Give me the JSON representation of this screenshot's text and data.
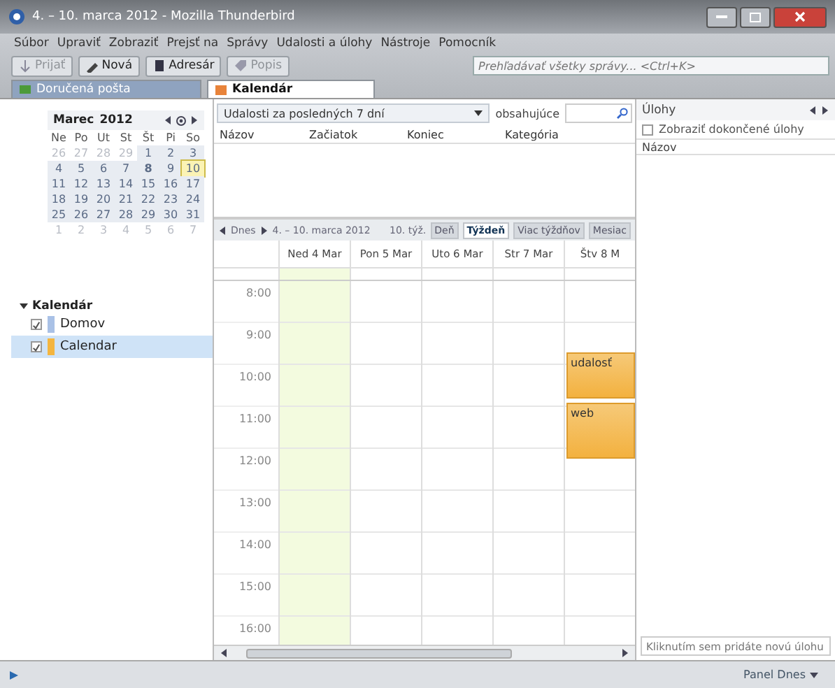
{
  "window": {
    "title": "4. – 10. marca 2012 - Mozilla Thunderbird"
  },
  "menu": [
    "Súbor",
    "Upraviť",
    "Zobraziť",
    "Prejsť na",
    "Správy",
    "Udalosti a úlohy",
    "Nástroje",
    "Pomocník"
  ],
  "toolbar": [
    {
      "label": "Prijať",
      "kind": "get",
      "disabled": true
    },
    {
      "label": "Nová",
      "kind": "new",
      "disabled": false
    },
    {
      "label": "Adresár",
      "kind": "book",
      "disabled": false
    },
    {
      "label": "Popis",
      "kind": "tag",
      "disabled": true
    }
  ],
  "global_search": {
    "placeholder": "Prehľadávať všetky správy... <Ctrl+K>"
  },
  "tabs": [
    {
      "label": "Doručená pošta",
      "kind": "mail",
      "selected": false
    },
    {
      "label": "Kalendár",
      "kind": "calendar",
      "selected": true
    }
  ],
  "minicalendar": {
    "month": "Marec",
    "year": "2012",
    "weekdays": [
      "Ne",
      "Po",
      "Ut",
      "St",
      "Št",
      "Pi",
      "So"
    ],
    "weeks": [
      [
        {
          "d": "26",
          "muted": true
        },
        {
          "d": "27",
          "muted": true
        },
        {
          "d": "28",
          "muted": true
        },
        {
          "d": "29",
          "muted": true
        },
        {
          "d": "1",
          "muted": false
        },
        {
          "d": "2",
          "muted": false
        },
        {
          "d": "3",
          "muted": false
        }
      ],
      [
        {
          "d": "4",
          "muted": false
        },
        {
          "d": "5",
          "muted": false
        },
        {
          "d": "6",
          "muted": false
        },
        {
          "d": "7",
          "muted": false
        },
        {
          "d": "8",
          "muted": false,
          "bold": true
        },
        {
          "d": "9",
          "muted": false
        },
        {
          "d": "10",
          "muted": false,
          "selected": true
        }
      ],
      [
        {
          "d": "11",
          "muted": false
        },
        {
          "d": "12",
          "muted": false
        },
        {
          "d": "13",
          "muted": false
        },
        {
          "d": "14",
          "muted": false
        },
        {
          "d": "15",
          "muted": false
        },
        {
          "d": "16",
          "muted": false
        },
        {
          "d": "17",
          "muted": false
        }
      ],
      [
        {
          "d": "18",
          "muted": false
        },
        {
          "d": "19",
          "muted": false
        },
        {
          "d": "20",
          "muted": false
        },
        {
          "d": "21",
          "muted": false
        },
        {
          "d": "22",
          "muted": false
        },
        {
          "d": "23",
          "muted": false
        },
        {
          "d": "24",
          "muted": false
        }
      ],
      [
        {
          "d": "25",
          "muted": false
        },
        {
          "d": "26",
          "muted": false
        },
        {
          "d": "27",
          "muted": false
        },
        {
          "d": "28",
          "muted": false
        },
        {
          "d": "29",
          "muted": false
        },
        {
          "d": "30",
          "muted": false
        },
        {
          "d": "31",
          "muted": false
        }
      ],
      [
        {
          "d": "1",
          "muted": true
        },
        {
          "d": "2",
          "muted": true
        },
        {
          "d": "3",
          "muted": true
        },
        {
          "d": "4",
          "muted": true
        },
        {
          "d": "5",
          "muted": true
        },
        {
          "d": "6",
          "muted": true
        },
        {
          "d": "7",
          "muted": true
        }
      ]
    ]
  },
  "calendars": {
    "title": "Kalendár",
    "expanded": true,
    "items": [
      {
        "name": "Domov",
        "color": "#a9c1e6",
        "checked": true,
        "selected": false
      },
      {
        "name": "Calendar",
        "color": "#f4b53f",
        "checked": true,
        "selected": true
      }
    ]
  },
  "filter": {
    "value": "Udalosti za posledných 7 dní",
    "contains_label": "obsahujúce"
  },
  "event_columns": [
    "Názov",
    "Začiatok",
    "Koniec",
    "Kategória"
  ],
  "nav": {
    "today": "Dnes",
    "range": "4. – 10. marca 2012",
    "week": "10. týž.",
    "views": [
      {
        "label": "Deň",
        "selected": false
      },
      {
        "label": "Týždeň",
        "selected": true
      },
      {
        "label": "Viac týždňov",
        "selected": false
      },
      {
        "label": "Mesiac",
        "selected": false
      }
    ]
  },
  "days": [
    {
      "label": "Ned 4 Mar",
      "weekend": true
    },
    {
      "label": "Pon 5 Mar",
      "weekend": false
    },
    {
      "label": "Uto 6 Mar",
      "weekend": false
    },
    {
      "label": "Str 7 Mar",
      "weekend": false
    },
    {
      "label": "Štv 8 M",
      "weekend": false,
      "events": [
        {
          "title": "udalosť"
        },
        {
          "title": "web"
        }
      ]
    }
  ],
  "hours": [
    "8:00",
    "9:00",
    "10:00",
    "11:00",
    "12:00",
    "13:00",
    "14:00",
    "15:00",
    "16:00"
  ],
  "tasks": {
    "title": "Úlohy",
    "show_completed": {
      "label": "Zobraziť dokončené úlohy",
      "checked": false
    },
    "column": "Názov",
    "new_task": {
      "placeholder": "Kliknutím sem pridáte novú úlohu"
    }
  },
  "status_bar": {
    "today_pane": "Panel Dnes"
  }
}
